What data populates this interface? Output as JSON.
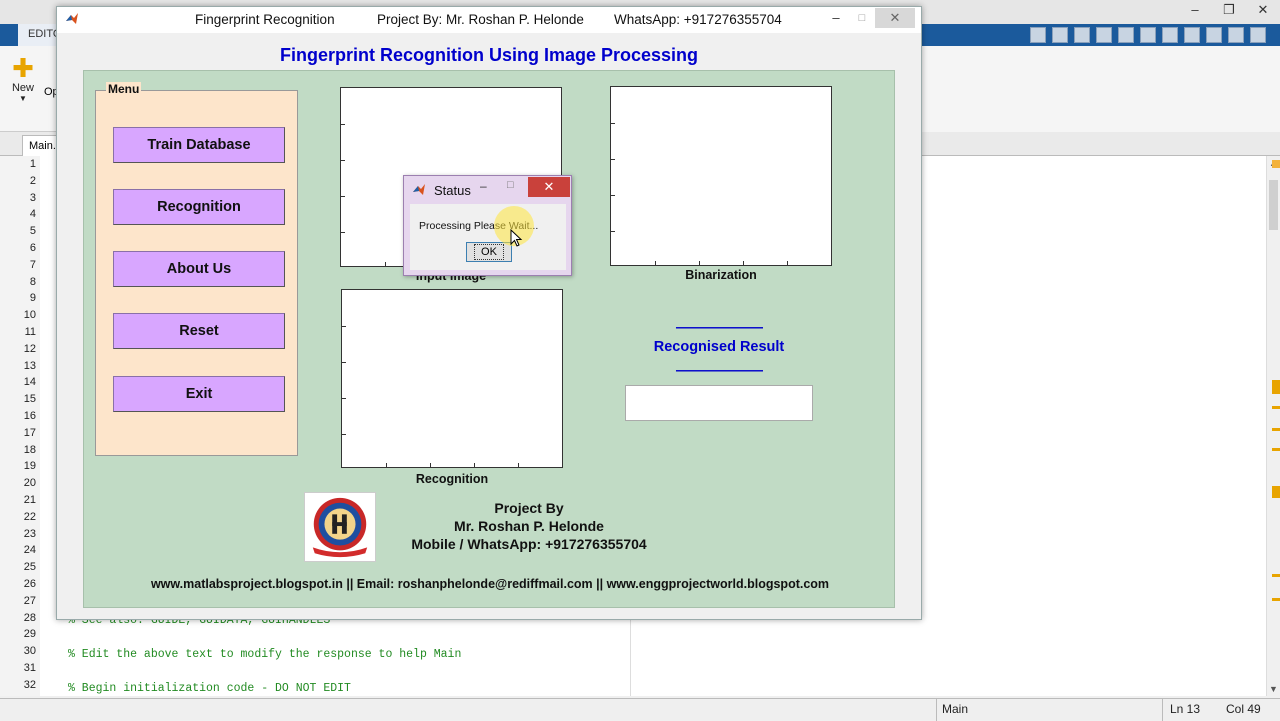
{
  "background": {
    "ribbon_tab": "EDITO",
    "new_label": "New",
    "open_label": "Op",
    "file_tab": "Main.",
    "line_numbers": [
      "1",
      "2",
      "3",
      "4",
      "5",
      "6",
      "7",
      "8",
      "9",
      "10",
      "11",
      "12",
      "13",
      "14",
      "15",
      "16",
      "17",
      "18",
      "19",
      "20",
      "21",
      "22",
      "23",
      "24",
      "25",
      "26",
      "27",
      "28",
      "29",
      "30",
      "31",
      "32"
    ],
    "code_lines": [
      "% See also: GUIDE, GUIDATA, GUIHANDLES",
      "% Edit the above text to modify the response to help Main",
      "% Begin initialization code - DO NOT EDIT"
    ],
    "status_bar": {
      "func": "Main",
      "ln": "Ln  13",
      "col": "Col  49"
    }
  },
  "window": {
    "title": "Fingerprint Recognition",
    "project": "Project By: Mr. Roshan P. Helonde",
    "whatsapp": "WhatsApp: +917276355704",
    "min": "–",
    "max": "□",
    "close": "✕"
  },
  "header": "Fingerprint Recognition Using Image Processing",
  "menu": {
    "title": "Menu",
    "buttons": [
      "Train Database",
      "Recognition",
      "About Us",
      "Reset",
      "Exit"
    ]
  },
  "axes_labels": {
    "input": "Input Image",
    "binarization": "Binarization",
    "recognition": "Recognition"
  },
  "result": {
    "dashes": "-----------------------------",
    "title": "Recognised Result",
    "value": ""
  },
  "credits": {
    "line1": "Project By",
    "line2": "Mr. Roshan P. Helonde",
    "line3": "Mobile / WhatsApp: +917276355704"
  },
  "footer": "www.matlabsproject.blogspot.in   || Email: roshanphelonde@rediffmail.com  ||   www.enggprojectworld.blogspot.com",
  "dialog": {
    "title": "Status",
    "message": "Processing Please Wait...",
    "ok": "OK",
    "min": "–",
    "max": "□",
    "close": "✕"
  },
  "colors": {
    "header_blue": "#0000cc",
    "panel_green": "#c1dbc5",
    "menu_bg": "#fde5cb",
    "button_purple": "#d8a6ff"
  }
}
